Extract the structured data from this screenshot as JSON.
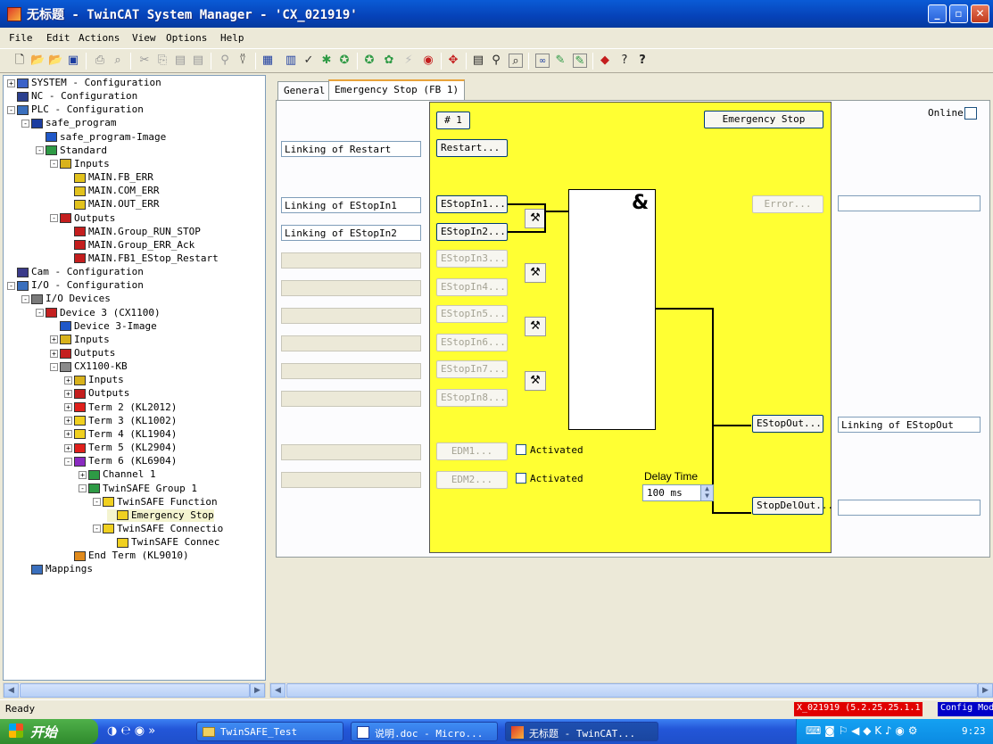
{
  "window": {
    "title": "无标题 - TwinCAT System Manager - 'CX_021919'",
    "buttons": {
      "minimize": "_",
      "maximize": "▫",
      "close": "✕"
    }
  },
  "menu": [
    "File",
    "Edit",
    "Actions",
    "View",
    "Options",
    "Help"
  ],
  "toolbar_icons": [
    "new-icon",
    "open-icon",
    "open-remote-icon",
    "save-icon",
    "print-icon",
    "print-preview-icon",
    "cut-icon",
    "copy-icon",
    "paste-icon",
    "paste-with-links-icon",
    "find-icon",
    "delete-icon",
    "generate-mappings-icon",
    "check-configuration-icon",
    "activate-configuration-icon",
    "set-run-mode-icon",
    "restart-config-mode-icon",
    "reload-devices-icon",
    "scan-devices-icon",
    "toggle-free-run-icon",
    "show-online-data-icon",
    "sort-icon",
    "zoom-icon",
    "show-variables-icon",
    "watch-icon",
    "trace-icon",
    "tcp-icon",
    "target-icon",
    "info-icon",
    "help-icon"
  ],
  "tree": [
    {
      "label": "SYSTEM - Configuration",
      "depth": 0,
      "exp": "+",
      "icon": "system-icon",
      "color": "#3b62c8"
    },
    {
      "label": "NC - Configuration",
      "depth": 0,
      "exp": "",
      "icon": "nc-icon",
      "color": "#2a3f8f"
    },
    {
      "label": "PLC - Configuration",
      "depth": 0,
      "exp": "-",
      "icon": "plc-icon",
      "color": "#3a6fbd"
    },
    {
      "label": "safe_program",
      "depth": 1,
      "exp": "-",
      "icon": "iec-icon",
      "color": "#1c3da0"
    },
    {
      "label": "safe_program-Image",
      "depth": 2,
      "exp": "",
      "icon": "image-icon",
      "color": "#2058c8"
    },
    {
      "label": "Standard",
      "depth": 2,
      "exp": "-",
      "icon": "standard-icon",
      "color": "#2e9a45"
    },
    {
      "label": "Inputs",
      "depth": 3,
      "exp": "-",
      "icon": "inputs-icon",
      "color": "#d8b21c"
    },
    {
      "label": "MAIN.FB_ERR",
      "depth": 4,
      "exp": "",
      "icon": "input-var-icon",
      "color": "#e2c21d"
    },
    {
      "label": "MAIN.COM_ERR",
      "depth": 4,
      "exp": "",
      "icon": "input-var-icon",
      "color": "#e2c21d"
    },
    {
      "label": "MAIN.OUT_ERR",
      "depth": 4,
      "exp": "",
      "icon": "input-var-icon",
      "color": "#e2c21d"
    },
    {
      "label": "Outputs",
      "depth": 3,
      "exp": "-",
      "icon": "outputs-icon",
      "color": "#c41e1e"
    },
    {
      "label": "MAIN.Group_RUN_STOP",
      "depth": 4,
      "exp": "",
      "icon": "output-var-icon",
      "color": "#c41e1e"
    },
    {
      "label": "MAIN.Group_ERR_Ack",
      "depth": 4,
      "exp": "",
      "icon": "output-var-icon",
      "color": "#c41e1e"
    },
    {
      "label": "MAIN.FB1_EStop_Restart",
      "depth": 4,
      "exp": "",
      "icon": "output-var-linked-icon",
      "color": "#c41e1e"
    },
    {
      "label": "Cam - Configuration",
      "depth": 0,
      "exp": "",
      "icon": "cam-icon",
      "color": "#3b3b8a"
    },
    {
      "label": "I/O - Configuration",
      "depth": 0,
      "exp": "-",
      "icon": "io-icon",
      "color": "#3a6fbd"
    },
    {
      "label": "I/O Devices",
      "depth": 1,
      "exp": "-",
      "icon": "io-devices-icon",
      "color": "#7a7a7a"
    },
    {
      "label": "Device 3 (CX1100)",
      "depth": 2,
      "exp": "-",
      "icon": "beckhoff-device-icon",
      "color": "#c42020"
    },
    {
      "label": "Device 3-Image",
      "depth": 3,
      "exp": "",
      "icon": "image-icon",
      "color": "#2058c8"
    },
    {
      "label": "Inputs",
      "depth": 3,
      "exp": "+",
      "icon": "inputs-icon",
      "color": "#d8b21c"
    },
    {
      "label": "Outputs",
      "depth": 3,
      "exp": "+",
      "icon": "outputs-icon",
      "color": "#c41e1e"
    },
    {
      "label": "CX1100-KB",
      "depth": 3,
      "exp": "-",
      "icon": "bus-coupler-icon",
      "color": "#8a8a8a"
    },
    {
      "label": "Inputs",
      "depth": 4,
      "exp": "+",
      "icon": "inputs-icon",
      "color": "#d8b21c"
    },
    {
      "label": "Outputs",
      "depth": 4,
      "exp": "+",
      "icon": "outputs-icon",
      "color": "#c41e1e"
    },
    {
      "label": "Term 2 (KL2012)",
      "depth": 4,
      "exp": "+",
      "icon": "terminal-red-icon",
      "color": "#e0201c"
    },
    {
      "label": "Term 3 (KL1002)",
      "depth": 4,
      "exp": "+",
      "icon": "terminal-yellow-icon",
      "color": "#f0d020"
    },
    {
      "label": "Term 4 (KL1904)",
      "depth": 4,
      "exp": "+",
      "icon": "terminal-yellow-icon",
      "color": "#f0d020"
    },
    {
      "label": "Term 5 (KL2904)",
      "depth": 4,
      "exp": "+",
      "icon": "terminal-red-icon",
      "color": "#e0201c"
    },
    {
      "label": "Term 6 (KL6904)",
      "depth": 4,
      "exp": "-",
      "icon": "terminal-purple-icon",
      "color": "#8a2ac0"
    },
    {
      "label": "Channel 1",
      "depth": 5,
      "exp": "+",
      "icon": "channel-icon",
      "color": "#2e9a45"
    },
    {
      "label": "TwinSAFE Group 1",
      "depth": 5,
      "exp": "-",
      "icon": "twinsafe-group-icon",
      "color": "#2e9a45"
    },
    {
      "label": "TwinSAFE Function",
      "depth": 6,
      "exp": "-",
      "icon": "twinsafe-function-icon",
      "color": "#f0d020"
    },
    {
      "label": "Emergency Stop",
      "depth": 7,
      "exp": "",
      "icon": "fb-icon",
      "color": "#f0d020",
      "selected": true
    },
    {
      "label": "TwinSAFE Connectio",
      "depth": 6,
      "exp": "-",
      "icon": "twinsafe-connection-icon",
      "color": "#f0d020"
    },
    {
      "label": "TwinSAFE Connec",
      "depth": 7,
      "exp": "",
      "icon": "connection-icon",
      "color": "#f0d020"
    },
    {
      "label": "End Term (KL9010)",
      "depth": 4,
      "exp": "",
      "icon": "end-terminal-icon",
      "color": "#e08a1c"
    },
    {
      "label": "Mappings",
      "depth": 1,
      "exp": "",
      "icon": "mappings-icon",
      "color": "#3a6fbd"
    }
  ],
  "tabs": {
    "general": "General",
    "estop": "Emergency Stop (FB 1)"
  },
  "fb": {
    "number": "# 1",
    "name": "Emergency Stop",
    "and_symbol": "&",
    "online_label": "Online",
    "restart": "Restart...",
    "inputs": [
      "EStopIn1...",
      "EStopIn2...",
      "EStopIn3...",
      "EStopIn4...",
      "EStopIn5...",
      "EStopIn6...",
      "EStopIn7...",
      "EStopIn8..."
    ],
    "edm": [
      "EDM1...",
      "EDM2..."
    ],
    "activated": "Activated",
    "delay_label": "Delay Time",
    "delay_value": "100 ms",
    "error": "Error...",
    "estopout": "EStopOut...",
    "stopdelout": "StopDelOut..."
  },
  "links": {
    "restart": "Linking of Restart",
    "in1": "Linking of EStopIn1",
    "in2": "Linking of EStopIn2",
    "estopout": "Linking of EStopOut"
  },
  "status": {
    "text": "Ready",
    "target": "X_021919 (5.2.25.25.1.1",
    "mode": "Config Mode"
  },
  "taskbar": {
    "start": "开始",
    "tasks": [
      "TwinSAFE_Test",
      "说明.doc - Micro...",
      "无标题 - TwinCAT..."
    ],
    "clock": "9:23"
  }
}
